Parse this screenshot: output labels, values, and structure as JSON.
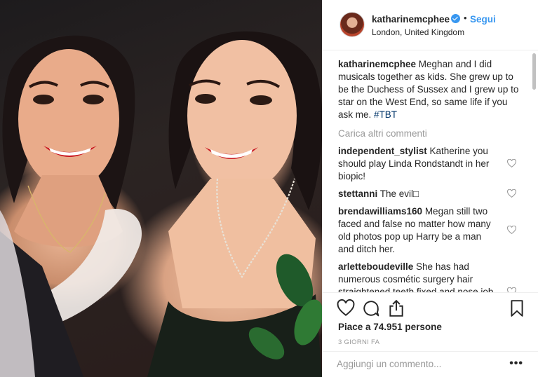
{
  "post": {
    "username": "katharinemcphee",
    "follow_label": "Segui",
    "dot_separator": "•",
    "location": "London, United Kingdom",
    "verified_icon": "verified-badge-icon",
    "colors": {
      "accent": "#3897f0",
      "text": "#262626",
      "muted": "#999999",
      "hashtag": "#003569"
    }
  },
  "caption": {
    "username": "katharinemcphee",
    "text": " Meghan and I did musicals together as kids. She grew up to be the Duchess of Sussex and I grew up to star on the West End, so same life if you ask me. ",
    "hashtag": "#TBT"
  },
  "load_more_label": "Carica altri commenti",
  "comments": [
    {
      "username": "independent_stylist",
      "text": " Katherine you should play Linda Rondstandt in her biopic!"
    },
    {
      "username": "stettanni",
      "text": " The evil□"
    },
    {
      "username": "brendawilliams160",
      "text": " Megan still two faced and false no matter how many old photos pop up Harry be a man and ditch her."
    },
    {
      "username": "arletteboudeville",
      "text": " She has had numerous cosmétic surgery hair straightened teeth fixed and nose job it has helped to improve her image considerably"
    }
  ],
  "actions": {
    "icons": [
      "heart-icon",
      "comment-icon",
      "share-icon",
      "bookmark-icon"
    ],
    "likes": "Piace a 74.951 persone",
    "timestamp": "3 GIORNI FA"
  },
  "add_comment": {
    "placeholder": "Aggiungi un commento...",
    "more_label": "•••"
  }
}
